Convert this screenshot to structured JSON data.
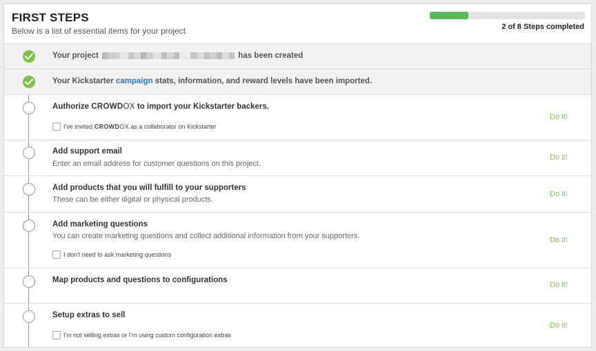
{
  "header": {
    "title": "FIRST STEPS",
    "subtitle": "Below is a list of essential items for your project",
    "progress_fraction": 0.25,
    "progress_text": "2 of 8 Steps completed"
  },
  "colors": {
    "accent_green": "#7bc144",
    "progress_green": "#5cb85c",
    "link_blue": "#2a7ab8"
  },
  "brand": {
    "bold": "CROWD",
    "light": "OX"
  },
  "steps": {
    "s1": {
      "title_pre": "Your project",
      "title_post": "has been created",
      "done": true
    },
    "s2": {
      "title_pre": "Your Kickstarter",
      "link": "campaign",
      "title_post": "stats, information, and reward levels have been imported.",
      "done": true
    },
    "s3": {
      "title_pre": "Authorize",
      "title_post": "to import your Kickstarter backers.",
      "checkbox_pre": "I've invited",
      "checkbox_post": "as a collaborator on Kickstarter",
      "action": "Do it!"
    },
    "s4": {
      "title": "Add support email",
      "desc": "Enter an email address for customer questions on this project.",
      "action": "Do it!"
    },
    "s5": {
      "title": "Add products that you will fulfill to your supporters",
      "desc": "These can be either digital or physical products.",
      "action": "Do it!"
    },
    "s6": {
      "title": "Add marketing questions",
      "desc": "You can create marketing questions and collect additional information from your supporters.",
      "checkbox": "I don't need to ask marketing questions",
      "action": "Do it!"
    },
    "s7": {
      "title": "Map products and questions to configurations",
      "action": "Do it!"
    },
    "s8": {
      "title": "Setup extras to sell",
      "checkbox": "I'm not selling extras or I'm using custom configuration extras",
      "action": "Do it!"
    }
  }
}
